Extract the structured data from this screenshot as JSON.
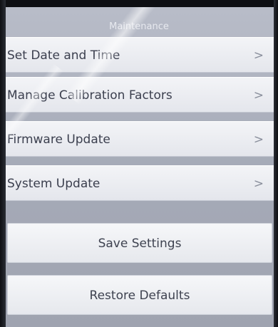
{
  "screen": {
    "section_title": "Maintenance"
  },
  "menu": {
    "items": [
      {
        "label": "Set Date and Time",
        "chevron": ">"
      },
      {
        "label": "Manage Calibration Factors",
        "chevron": ">"
      },
      {
        "label": "Firmware Update",
        "chevron": ">"
      },
      {
        "label": "System Update",
        "chevron": ">"
      }
    ]
  },
  "actions": {
    "save_label": "Save Settings",
    "restore_label": "Restore Defaults"
  }
}
